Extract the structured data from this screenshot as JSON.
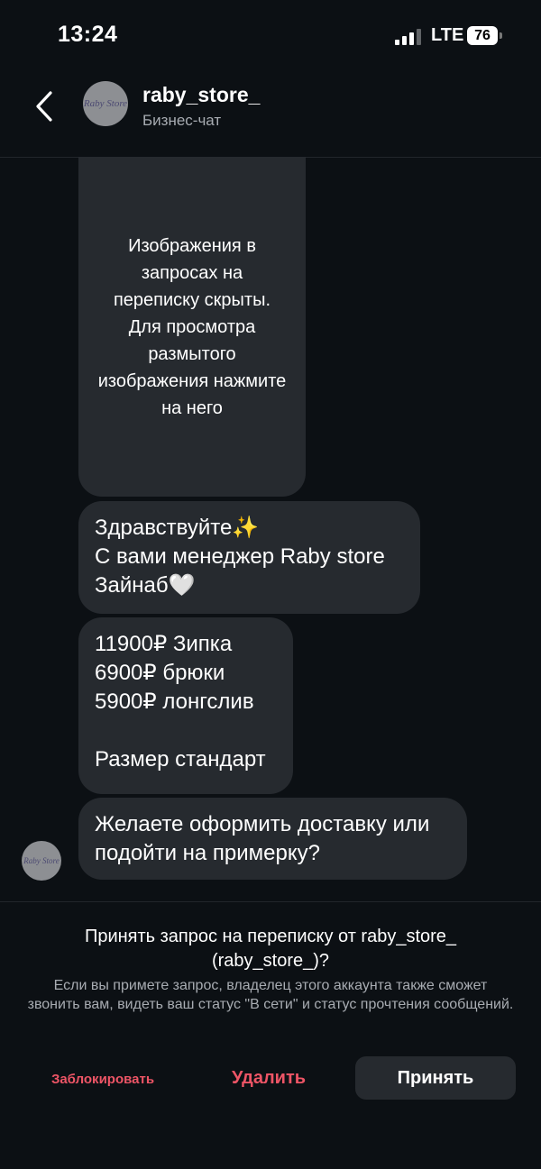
{
  "status_bar": {
    "time": "13:24",
    "network": "LTE",
    "battery": "76"
  },
  "header": {
    "title": "raby_store_",
    "subtitle": "Бизнес-чат",
    "avatar_logo_text": "Raby Store"
  },
  "messages": [
    {
      "text": "Изображения в запросах на переписку скрыты. Для просмотра размытого изображения нажмите на него"
    },
    {
      "text": "Здравствуйте✨\nС вами менеджер Raby store\nЗайнаб🤍"
    },
    {
      "text": "11900₽ Зипка\n6900₽ брюки\n5900₽ лонгслив\n\nРазмер стандарт"
    },
    {
      "text": "Желаете оформить доставку или\nподойти на примерку?"
    }
  ],
  "request": {
    "title": "Принять запрос на переписку от raby_store_ (raby_store_)?",
    "description": "Если вы примете запрос, владелец этого аккаунта также сможет звонить вам, видеть ваш статус \"В сети\" и статус прочтения сообщений."
  },
  "actions": {
    "block": "Заблокировать",
    "delete": "Удалить",
    "accept": "Принять"
  },
  "colors": {
    "background": "#0c1014",
    "bubble": "#262a2f",
    "danger": "#ee5566",
    "muted": "#a8acb2"
  }
}
